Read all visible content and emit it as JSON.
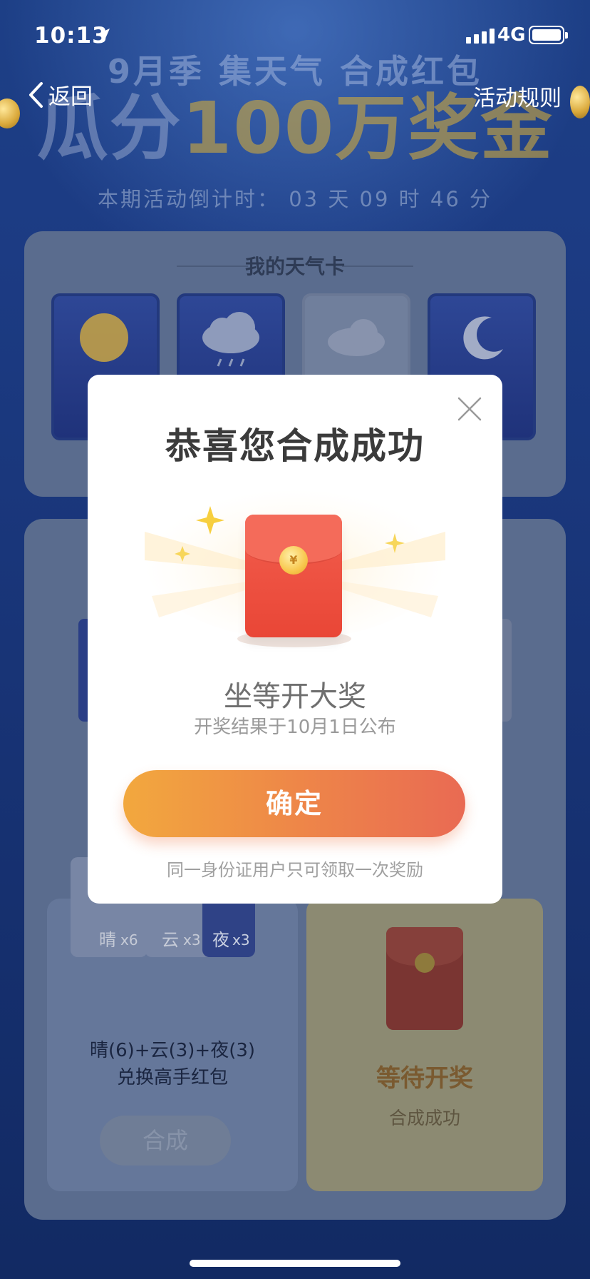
{
  "status_bar": {
    "time": "10:13",
    "network": "4G"
  },
  "nav": {
    "back_label": "返回",
    "rules_label": "活动规则"
  },
  "header": {
    "subtitle": "9月季 集天气 合成红包",
    "title_part1": "瓜分",
    "title_part2": "100万奖金",
    "countdown": "本期活动倒计时： 03 天 09 时 46 分"
  },
  "weather_cards": {
    "title": "我的天气卡"
  },
  "combo": {
    "mini_labels": [
      "晴",
      "云",
      "夜"
    ],
    "mini_counts": [
      "x6",
      "x3",
      "x3"
    ],
    "formula": "晴(6)+云(3)+夜(3)",
    "formula_desc": "兑换高手红包",
    "merge_label": "合成",
    "wait_label": "等待开奖",
    "done_label": "合成成功"
  },
  "modal": {
    "title": "恭喜您合成成功",
    "coin_symbol": "¥",
    "subtitle": "坐等开大奖",
    "note": "开奖结果于10月1日公布",
    "confirm_label": "确定",
    "footer": "同一身份证用户只可领取一次奖励"
  },
  "colors": {
    "accent_gradient_start": "#f2a83e",
    "accent_gradient_end": "#e96a53",
    "envelope_red": "#f25e4e",
    "background_blue": "#1c3b83"
  }
}
